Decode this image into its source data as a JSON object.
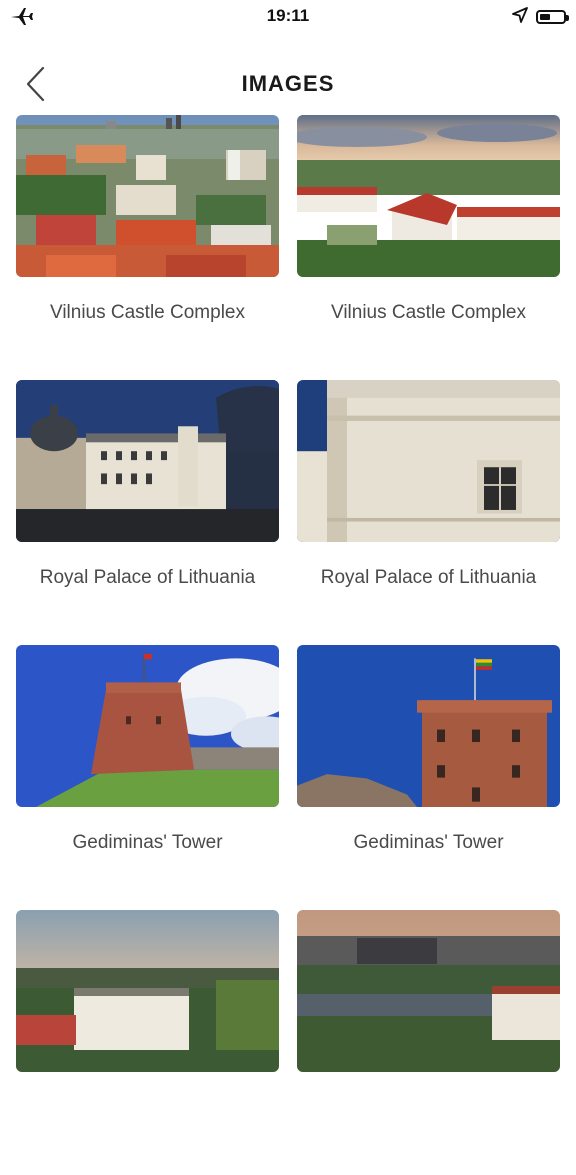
{
  "status_bar": {
    "time": "19:11",
    "left_icon": "airplane-icon",
    "right_icons": [
      "location-arrow-icon",
      "battery-icon"
    ],
    "battery_level": 0.45
  },
  "nav": {
    "title": "IMAGES",
    "back_icon": "chevron-left-icon"
  },
  "images": [
    {
      "label": "Vilnius Castle Complex",
      "scene": "city-rooftops"
    },
    {
      "label": "Vilnius Castle Complex",
      "scene": "red-roof-complex"
    },
    {
      "label": "Royal Palace of Lithuania",
      "scene": "palace-cathedral"
    },
    {
      "label": "Royal Palace of Lithuania",
      "scene": "palace-wall"
    },
    {
      "label": "Gediminas' Tower",
      "scene": "tower-hill"
    },
    {
      "label": "Gediminas' Tower",
      "scene": "tower-flag"
    },
    {
      "label": "",
      "scene": "sunset-buildings"
    },
    {
      "label": "",
      "scene": "river-city"
    }
  ],
  "colors": {
    "title": "#1a1a1a",
    "label": "#4a4a4a",
    "background": "#ffffff"
  }
}
